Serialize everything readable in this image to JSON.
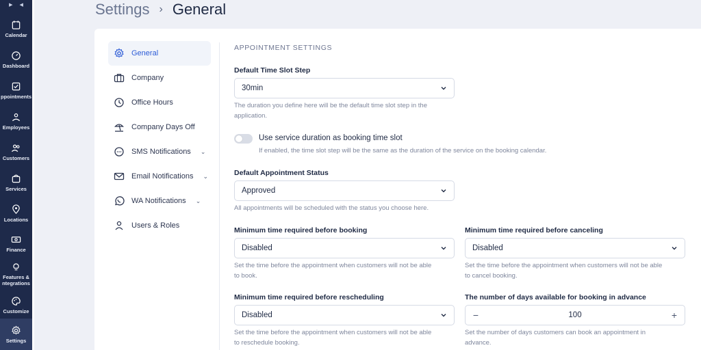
{
  "rail": {
    "items": [
      {
        "label": "Calendar",
        "icon": "calendar-icon"
      },
      {
        "label": "Dashboard",
        "icon": "gauge-icon"
      },
      {
        "label": "ppointments",
        "icon": "checklist-icon"
      },
      {
        "label": "Employees",
        "icon": "employees-icon"
      },
      {
        "label": "Customers",
        "icon": "customers-icon"
      },
      {
        "label": "Services",
        "icon": "bag-icon"
      },
      {
        "label": "Locations",
        "icon": "map-pin-icon"
      },
      {
        "label": "Finance",
        "icon": "money-icon"
      },
      {
        "label": "Features &",
        "label2": "ntegrations",
        "icon": "bulb-icon"
      },
      {
        "label": "Customize",
        "icon": "palette-icon"
      },
      {
        "label": "Settings",
        "icon": "gear-icon"
      }
    ]
  },
  "header": {
    "parent": "Settings",
    "separator": "›",
    "current": "General"
  },
  "sidebar": {
    "items": [
      {
        "label": "General",
        "icon": "gear-icon"
      },
      {
        "label": "Company",
        "icon": "briefcase-icon"
      },
      {
        "label": "Office Hours",
        "icon": "clock-icon"
      },
      {
        "label": "Company Days Off",
        "icon": "beach-icon"
      },
      {
        "label": "SMS Notifications",
        "icon": "chat-icon"
      },
      {
        "label": "Email Notifications",
        "icon": "mail-icon"
      },
      {
        "label": "WA Notifications",
        "icon": "whatsapp-icon"
      },
      {
        "label": "Users & Roles",
        "icon": "user-icon"
      }
    ]
  },
  "main": {
    "section_title": "APPOINTMENT SETTINGS",
    "time_slot": {
      "label": "Default Time Slot Step",
      "value": "30min",
      "help1": "The duration you define here will be the default time slot step in the",
      "help2": "application."
    },
    "service_duration": {
      "title": "Use service duration as booking time slot",
      "help": "If enabled, the time slot step will be the same as the duration of the service on the booking calendar.",
      "enabled": false
    },
    "status": {
      "label": "Default Appointment Status",
      "value": "Approved",
      "help": "All appointments will be scheduled with the status you choose here."
    },
    "before_booking": {
      "label": "Minimum time required before booking",
      "value": "Disabled",
      "help1": "Set the time before the appointment when customers will not be able",
      "help2": "to book."
    },
    "before_canceling": {
      "label": "Minimum time required before canceling",
      "value": "Disabled",
      "help1": "Set the time before the appointment when customers will not be able",
      "help2": "to cancel booking."
    },
    "before_rescheduling": {
      "label": "Minimum time required before rescheduling",
      "value": "Disabled",
      "help1": "Set the time before the appointment when customers will not be able",
      "help2": "to reschedule booking."
    },
    "days_advance": {
      "label": "The number of days available for booking in advance",
      "value": "100",
      "minus": "−",
      "plus": "+",
      "help1": "Set the number of days customers can book an appointment in",
      "help2": "advance."
    }
  },
  "colors": {
    "rail": "#1e2a4a",
    "accent": "#2c5bd6"
  }
}
